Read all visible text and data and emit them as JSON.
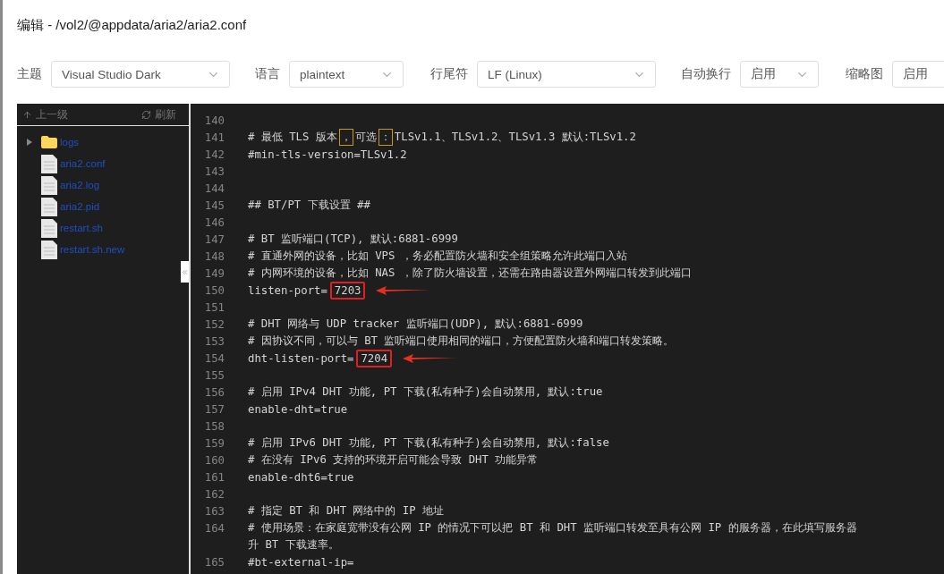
{
  "title": "编辑 - /vol2/@appdata/aria2/aria2.conf",
  "toolbar": [
    {
      "label": "主题",
      "value": "Visual Studio Dark",
      "kind": "wide"
    },
    {
      "label": "语言",
      "value": "plaintext",
      "kind": "narrow"
    },
    {
      "label": "行尾符",
      "value": "LF (Linux)",
      "kind": "wide"
    },
    {
      "label": "自动换行",
      "value": "启用",
      "kind": "small"
    },
    {
      "label": "缩略图",
      "value": "启用",
      "kind": "small"
    }
  ],
  "file_panel": {
    "up": "上一级",
    "refresh": "刷新",
    "collapsed": false,
    "items": [
      {
        "name": "logs",
        "kind": "folder",
        "expanded": false
      },
      {
        "name": "aria2.conf",
        "kind": "file"
      },
      {
        "name": "aria2.log",
        "kind": "file"
      },
      {
        "name": "aria2.pid",
        "kind": "file"
      },
      {
        "name": "restart.sh",
        "kind": "file"
      },
      {
        "name": "restart.sh.new",
        "kind": "file"
      }
    ]
  },
  "editor": {
    "lines": [
      {
        "number": "140"
      },
      {
        "number": "141",
        "parts": [
          {
            "kind": "text",
            "text": "# 最低 TLS 版本"
          },
          {
            "kind": "highlight",
            "text": "，"
          },
          {
            "kind": "text",
            "text": "可选"
          },
          {
            "kind": "highlight",
            "text": "："
          },
          {
            "kind": "text",
            "text": "TLSv1.1、TLSv1.2、TLSv1.3 默认:TLSv1.2"
          }
        ]
      },
      {
        "number": "142",
        "parts": [
          {
            "kind": "text",
            "text": "#min-tls-version=TLSv1.2"
          }
        ]
      },
      {
        "number": "143"
      },
      {
        "number": "144"
      },
      {
        "number": "145",
        "parts": [
          {
            "kind": "text",
            "text": "## BT/PT 下载设置 ##"
          }
        ]
      },
      {
        "number": "146"
      },
      {
        "number": "147",
        "parts": [
          {
            "kind": "text",
            "text": "# BT 监听端口(TCP), 默认:6881-6999"
          }
        ]
      },
      {
        "number": "148",
        "parts": [
          {
            "kind": "text",
            "text": "# 直通外网的设备，比如 VPS ，务必配置防火墙和安全组策略允许此端口入站"
          }
        ]
      },
      {
        "number": "149",
        "parts": [
          {
            "kind": "text",
            "text": "# 内网环境的设备，比如 NAS ，除了防火墙设置，还需在路由器设置外网端口转发到此端口"
          }
        ]
      },
      {
        "number": "150",
        "parts": [
          {
            "kind": "text",
            "text": "listen-port="
          },
          {
            "kind": "marked",
            "text": "7203"
          }
        ],
        "arrow": true
      },
      {
        "number": "151"
      },
      {
        "number": "152",
        "parts": [
          {
            "kind": "text",
            "text": "# DHT 网络与 UDP tracker 监听端口(UDP), 默认:6881-6999"
          }
        ]
      },
      {
        "number": "153",
        "parts": [
          {
            "kind": "text",
            "text": "# 因协议不同，可以与 BT 监听端口使用相同的端口，方便配置防火墙和端口转发策略。"
          }
        ]
      },
      {
        "number": "154",
        "parts": [
          {
            "kind": "text",
            "text": "dht-listen-port="
          },
          {
            "kind": "marked",
            "text": "7204"
          }
        ],
        "arrow": true
      },
      {
        "number": "155"
      },
      {
        "number": "156",
        "parts": [
          {
            "kind": "text",
            "text": "# 启用 IPv4 DHT 功能, PT 下载(私有种子)会自动禁用, 默认:true"
          }
        ]
      },
      {
        "number": "157",
        "parts": [
          {
            "kind": "text",
            "text": "enable-dht=true"
          }
        ]
      },
      {
        "number": "158"
      },
      {
        "number": "159",
        "parts": [
          {
            "kind": "text",
            "text": "# 启用 IPv6 DHT 功能, PT 下载(私有种子)会自动禁用, 默认:false"
          }
        ]
      },
      {
        "number": "160",
        "parts": [
          {
            "kind": "text",
            "text": "# 在没有 IPv6 支持的环境开启可能会导致 DHT 功能异常"
          }
        ]
      },
      {
        "number": "161",
        "parts": [
          {
            "kind": "text",
            "text": "enable-dht6=true"
          }
        ]
      },
      {
        "number": "162"
      },
      {
        "number": "163",
        "parts": [
          {
            "kind": "text",
            "text": "# 指定 BT 和 DHT 网络中的 IP 地址"
          }
        ]
      },
      {
        "number": "164",
        "parts": [
          {
            "kind": "text",
            "text": "# 使用场景：在家庭宽带没有公网 IP 的情况下可以把 BT 和 DHT 监听端口转发至具有公网 IP 的服务器，在此填写服务器"
          }
        ],
        "wrap": "升 BT 下载速率。"
      },
      {
        "number": "165",
        "parts": [
          {
            "kind": "text",
            "text": "#bt-external-ip="
          }
        ]
      }
    ]
  }
}
